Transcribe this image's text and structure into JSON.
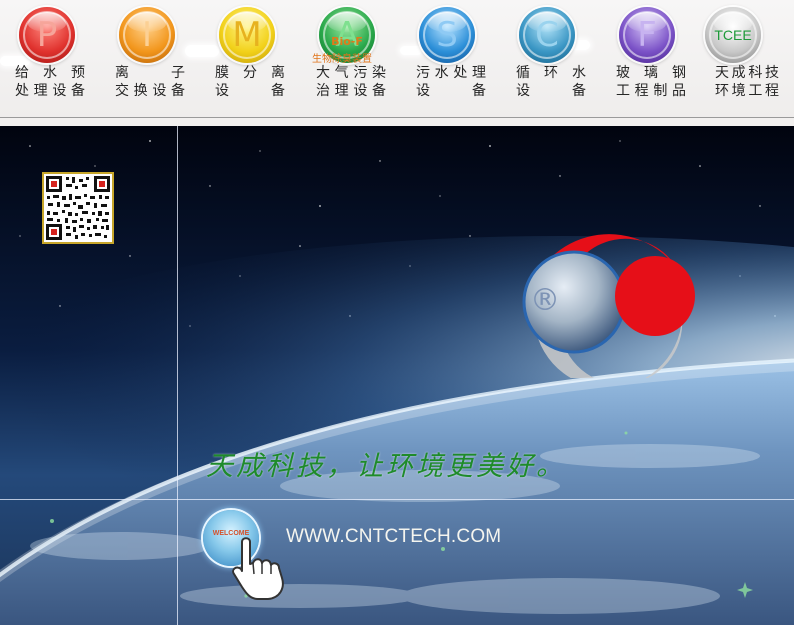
{
  "nav": {
    "items": [
      {
        "letter": "P",
        "line1": "给 水 预",
        "line2": "处理设备",
        "color": "#e0322e"
      },
      {
        "letter": "I",
        "line1": "离　　子",
        "line2": "交换设备",
        "color": "#f2961c"
      },
      {
        "letter": "M",
        "line1": "膜 分 离",
        "line2": "设　　备",
        "color": "#f2d11a"
      },
      {
        "letter": "A",
        "line1": "大气污染",
        "line2": "治理设备",
        "color": "#29a84a",
        "overlay": "Bio-F",
        "sub": "生物除臭装置"
      },
      {
        "letter": "S",
        "line1": "污水处理",
        "line2": "设　　备",
        "color": "#2c8fd8"
      },
      {
        "letter": "C",
        "line1": "循 环 水",
        "line2": "设　　备",
        "color": "#3a96c4"
      },
      {
        "letter": "F",
        "line1": "玻 璃 钢",
        "line2": "工程制品",
        "color": "#7b52c7"
      },
      {
        "letter": "TCEE",
        "line1": "天成科技",
        "line2": "环境工程",
        "color": "#a9a9a9"
      }
    ]
  },
  "banner": {
    "slogan": "天成科技，让环境更美好。",
    "website": "WWW.CNTCTECH.COM",
    "welcome_label": "WELCOME",
    "logo_mark": "®"
  }
}
